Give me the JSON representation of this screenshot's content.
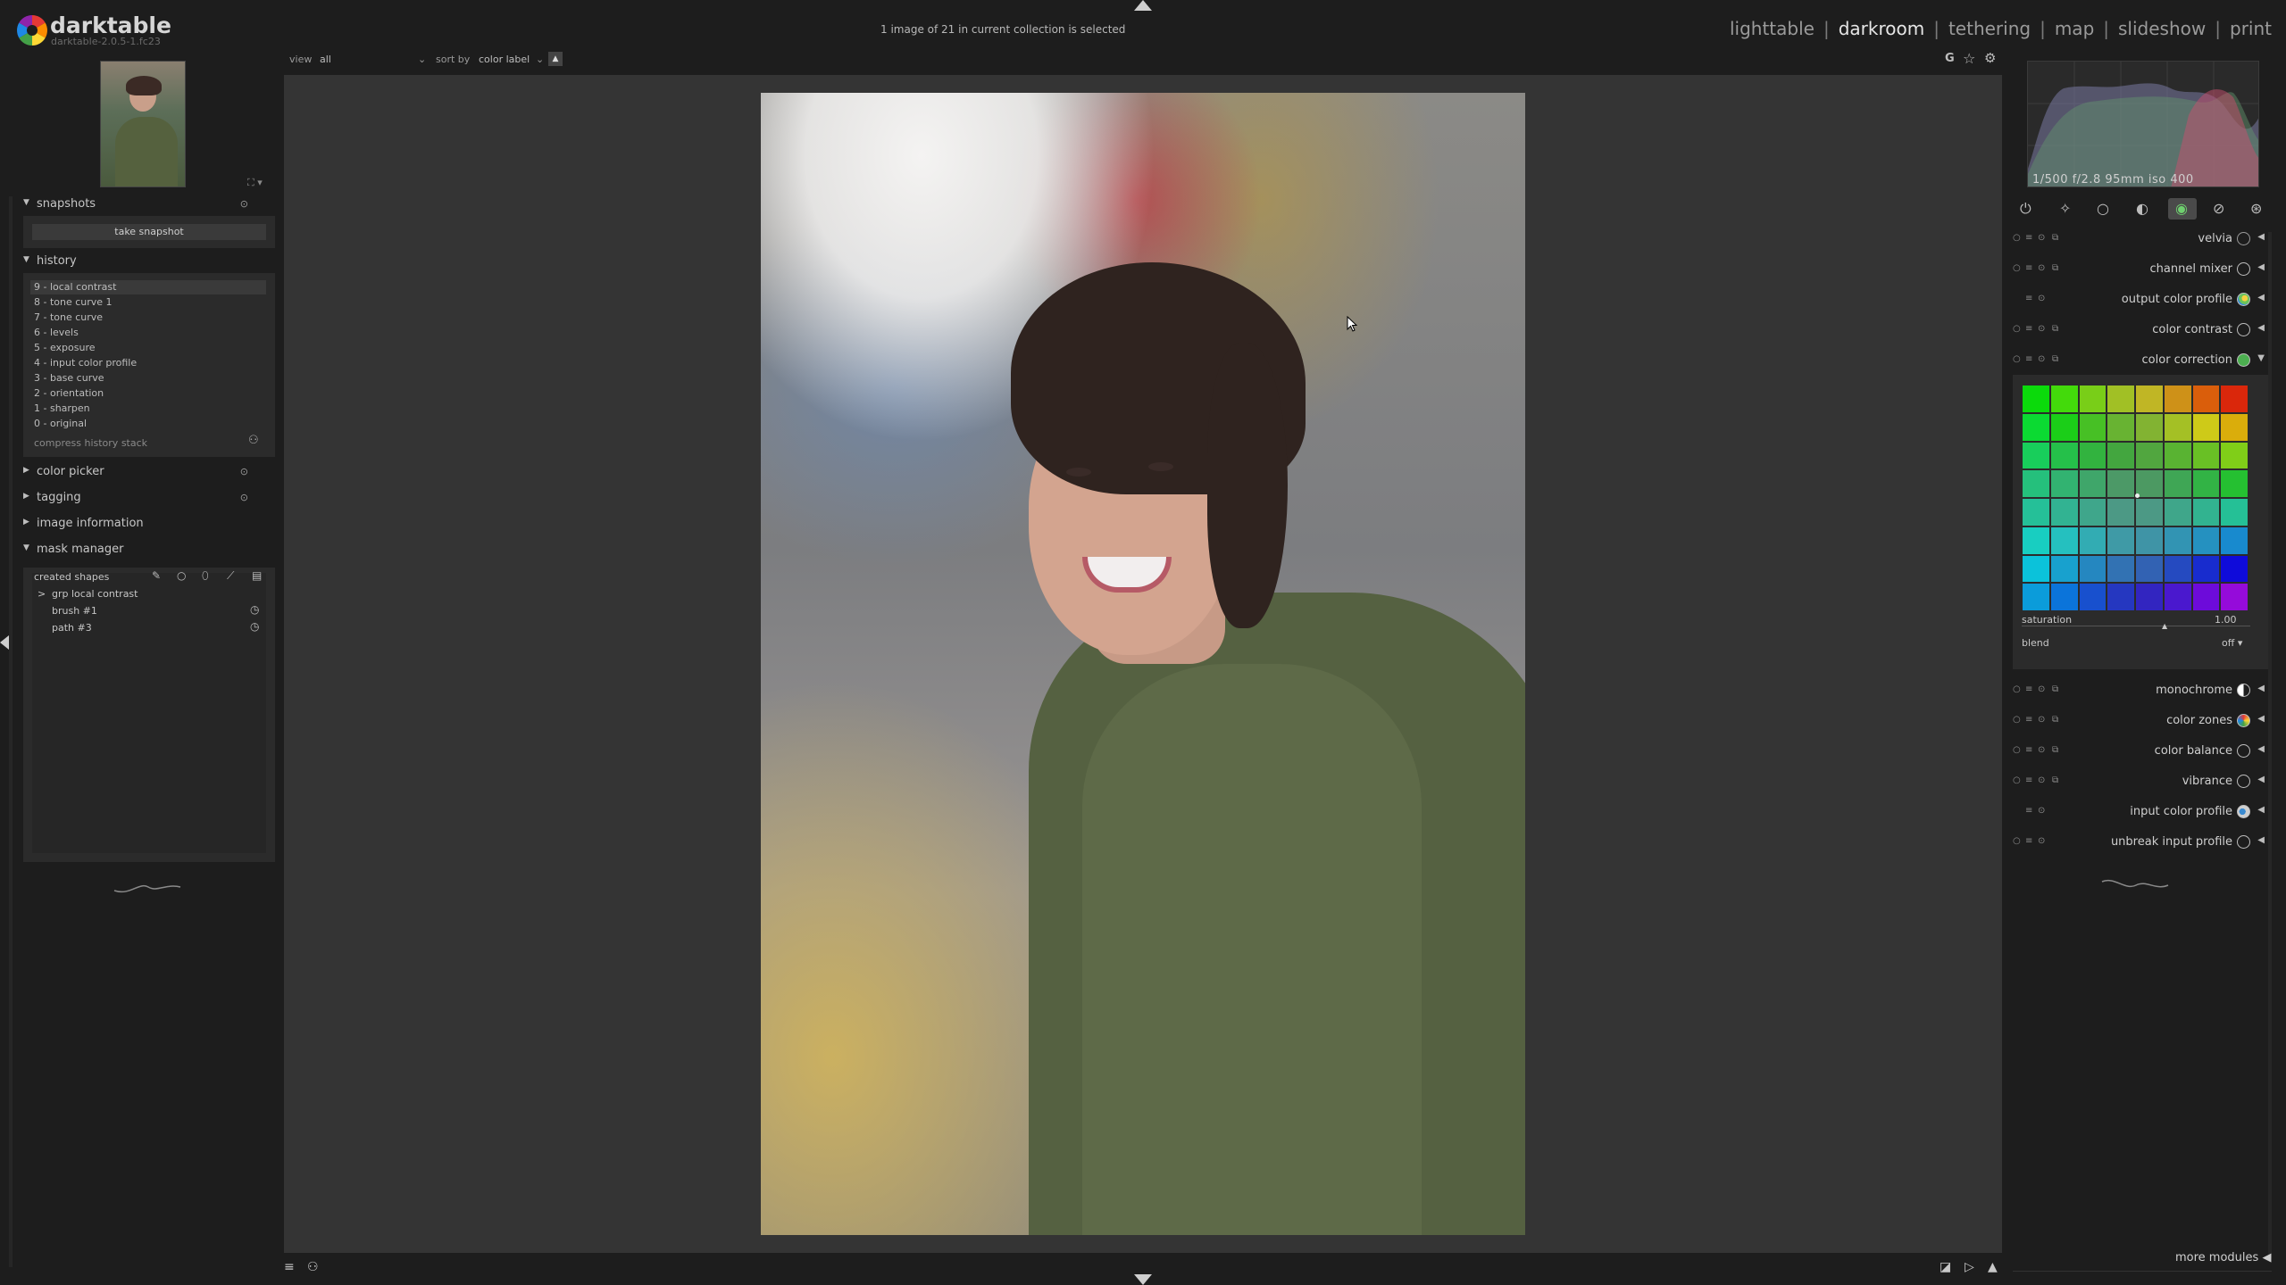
{
  "app": {
    "name": "darktable",
    "version": "darktable-2.0.5-1.fc23",
    "status": "1 image of 21 in current collection is selected"
  },
  "views": [
    "lighttable",
    "darkroom",
    "tethering",
    "map",
    "slideshow",
    "print"
  ],
  "active_view": "darkroom",
  "filter_bar": {
    "view_label": "view",
    "view_value": "all",
    "sort_label": "sort by",
    "sort_value": "color label"
  },
  "left_panel": {
    "snapshots": {
      "title": "snapshots",
      "take_snapshot": "take snapshot"
    },
    "history": {
      "title": "history",
      "items": [
        "9 - local contrast",
        "8 - tone curve 1",
        "7 - tone curve",
        "6 - levels",
        "5 - exposure",
        "4 - input color profile",
        "3 - base curve",
        "2 - orientation",
        "1 - sharpen",
        "0 - original"
      ],
      "compress": "compress history stack"
    },
    "color_picker": "color picker",
    "tagging": "tagging",
    "image_information": "image information",
    "mask_manager": {
      "title": "mask manager",
      "created_shapes": "created shapes",
      "group": "grp local contrast",
      "shapes": [
        "brush #1",
        "path #3"
      ]
    }
  },
  "right_panel": {
    "exif": "1/500 f/2.8 95mm iso 400",
    "modules": [
      "velvia",
      "channel mixer",
      "output color profile",
      "color contrast",
      "color correction",
      "monochrome",
      "color zones",
      "color balance",
      "vibrance",
      "input color profile",
      "unbreak input profile"
    ],
    "color_correction": {
      "saturation_label": "saturation",
      "saturation_value": "1.00",
      "saturation": 1.0,
      "blend_label": "blend",
      "blend_value": "off"
    },
    "more_modules": "more modules"
  },
  "icons": {
    "logo": "darktable-logo-icon",
    "grouping": "G",
    "colors": {
      "accent_green": "#4caf50",
      "bg": "#1d1d1d",
      "panel": "#2b2b2b"
    }
  }
}
